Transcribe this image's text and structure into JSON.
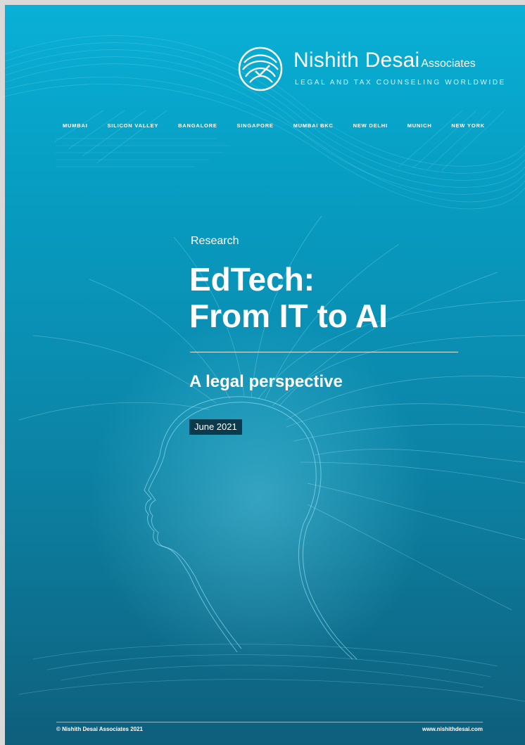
{
  "brand": {
    "name": "Nishith Desai",
    "suffix": "Associates",
    "tagline": "LEGAL AND TAX COUNSELING WORLDWIDE",
    "logo_icon": "nda-globe-logo-icon"
  },
  "cities": [
    "MUMBAI",
    "SILICON VALLEY",
    "BANGALORE",
    "SINGAPORE",
    "MUMBAI BKC",
    "NEW DELHI",
    "MUNICH",
    "NEW YORK"
  ],
  "cover": {
    "category": "Research",
    "title_line1": "EdTech:",
    "title_line2": "From IT to AI",
    "subtitle": "A legal perspective",
    "date": "June 2021",
    "illustration": "ai-head-neural-lines-illustration"
  },
  "footer": {
    "copyright": "© Nishith Desai Associates 2021",
    "website": "www.nishithdesai.com"
  },
  "colors": {
    "background_top": "#0ab0d6",
    "background_bottom": "#0e5f7c",
    "date_badge": "#0b3a4c",
    "text": "#ffffff"
  }
}
